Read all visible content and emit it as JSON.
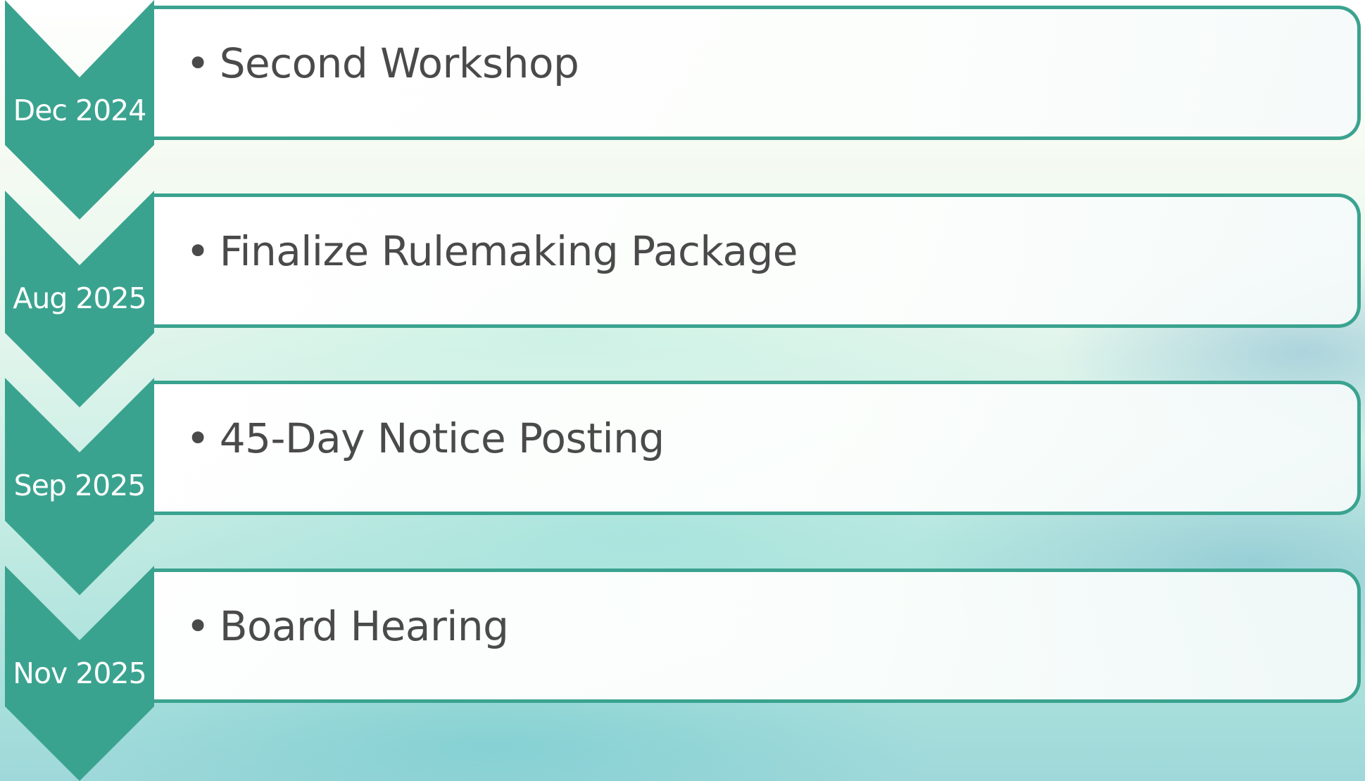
{
  "timeline": [
    {
      "date": "Dec 2024",
      "item": "Second Workshop"
    },
    {
      "date": "Aug 2025",
      "item": "Finalize Rulemaking Package"
    },
    {
      "date": "Sep 2025",
      "item": "45-Day Notice Posting"
    },
    {
      "date": "Nov 2025",
      "item": "Board Hearing"
    }
  ],
  "colors": {
    "chevron": "#3aa38f",
    "border": "#3aa38f",
    "text": "#4a4a4a"
  },
  "bullet_glyph": "•"
}
